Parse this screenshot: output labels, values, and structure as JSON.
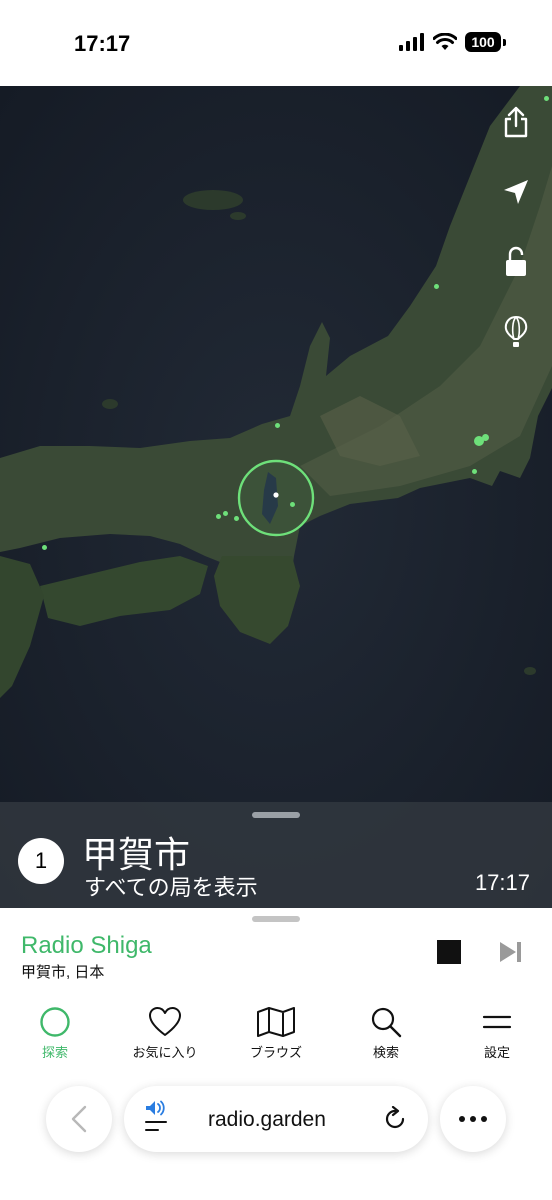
{
  "status_bar": {
    "time": "17:17",
    "battery": "100"
  },
  "map_tools": [
    "share-icon",
    "locate-arrow-icon",
    "unlock-icon",
    "balloon-icon"
  ],
  "info_panel": {
    "count": "1",
    "place": "甲賀市",
    "subtitle": "すべての局を表示",
    "local_time": "17:17"
  },
  "player": {
    "station": "Radio Shiga",
    "location": "甲賀市, 日本"
  },
  "tabs": [
    {
      "label": "探索",
      "icon": "explore-circle-icon",
      "active": true
    },
    {
      "label": "お気に入り",
      "icon": "heart-icon",
      "active": false
    },
    {
      "label": "ブラウズ",
      "icon": "map-icon",
      "active": false
    },
    {
      "label": "検索",
      "icon": "search-icon",
      "active": false
    },
    {
      "label": "設定",
      "icon": "menu-icon",
      "active": false
    }
  ],
  "browser": {
    "url": "radio.garden"
  },
  "colors": {
    "accent": "#3fb86a",
    "station_dot": "#6ee07a"
  }
}
